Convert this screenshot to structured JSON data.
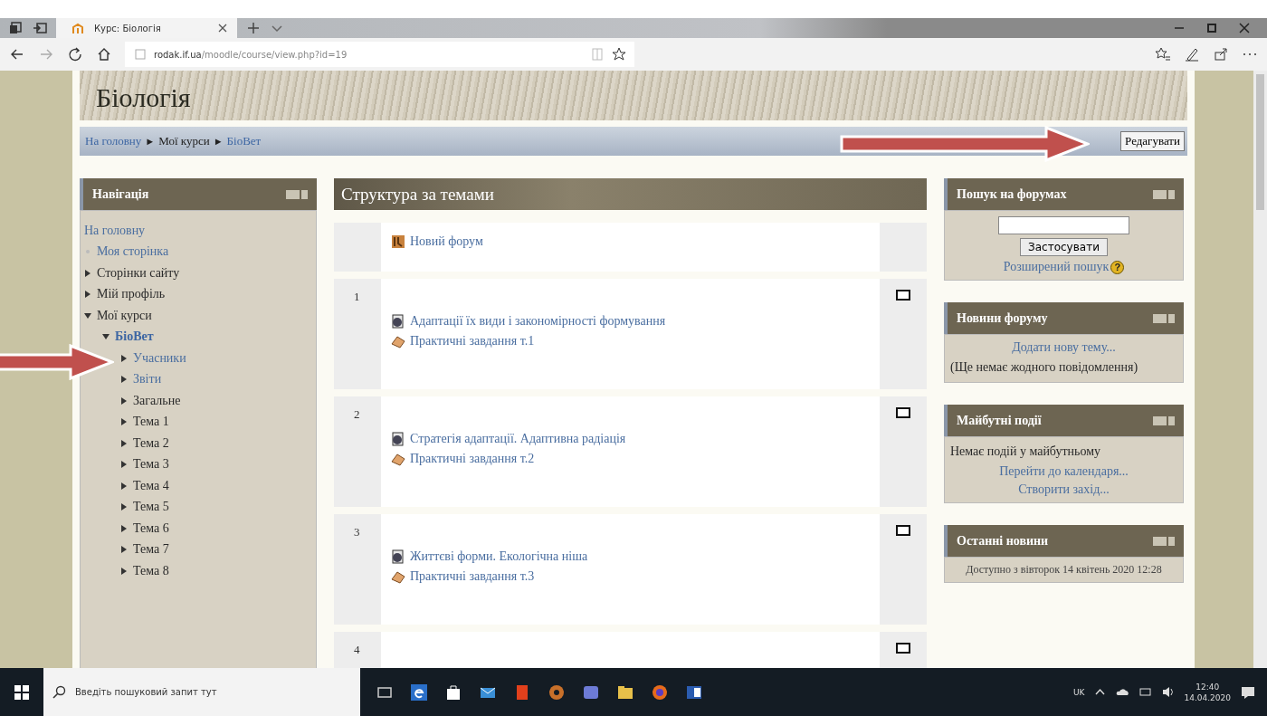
{
  "browser": {
    "tab_title": "Курс: Біологія",
    "url_host": "rodak.if.ua",
    "url_path": "/moodle/course/view.php?id=19"
  },
  "course": {
    "title": "Біологія"
  },
  "breadcrumb": {
    "items": [
      "На головну",
      "Мої курси",
      "БіоВет"
    ],
    "separator": "►"
  },
  "edit_button": "Редагувати",
  "navigation": {
    "title": "Навігація",
    "items": [
      {
        "label": "На головну",
        "kind": "home"
      },
      {
        "label": "Моя сторінка",
        "kind": "leaf"
      },
      {
        "label": "Сторінки сайту",
        "kind": "node",
        "expanded": false,
        "link": false
      },
      {
        "label": "Мій профіль",
        "kind": "node",
        "expanded": false,
        "link": false
      },
      {
        "label": "Мої курси",
        "kind": "node",
        "expanded": true,
        "link": false,
        "children": [
          {
            "label": "БіоВет",
            "kind": "node",
            "expanded": true,
            "link": true,
            "current": true,
            "children": [
              {
                "label": "Учасники",
                "kind": "node",
                "expanded": false,
                "link": true
              },
              {
                "label": "Звіти",
                "kind": "node",
                "expanded": false,
                "link": true
              },
              {
                "label": "Загальне",
                "kind": "node",
                "expanded": false,
                "link": false
              },
              {
                "label": "Тема 1",
                "kind": "node",
                "expanded": false,
                "link": false
              },
              {
                "label": "Тема 2",
                "kind": "node",
                "expanded": false,
                "link": false
              },
              {
                "label": "Тема 3",
                "kind": "node",
                "expanded": false,
                "link": false
              },
              {
                "label": "Тема 4",
                "kind": "node",
                "expanded": false,
                "link": false
              },
              {
                "label": "Тема 5",
                "kind": "node",
                "expanded": false,
                "link": false
              },
              {
                "label": "Тема 6",
                "kind": "node",
                "expanded": false,
                "link": false
              },
              {
                "label": "Тема 7",
                "kind": "node",
                "expanded": false,
                "link": false
              },
              {
                "label": "Тема 8",
                "kind": "node",
                "expanded": false,
                "link": false
              }
            ]
          }
        ]
      }
    ]
  },
  "topics": {
    "title": "Структура за темами",
    "sections": [
      {
        "activities": [
          {
            "kind": "forum",
            "title": "Новий форум"
          }
        ]
      },
      {
        "number": "1",
        "activities": [
          {
            "kind": "resource",
            "title": "Адаптації їх види і закономірності формування"
          },
          {
            "kind": "assignment",
            "title": "Практичні завдання т.1"
          }
        ]
      },
      {
        "number": "2",
        "activities": [
          {
            "kind": "resource",
            "title": "Стратегія адаптації. Адаптивна радіація"
          },
          {
            "kind": "assignment",
            "title": "Практичні завдання т.2"
          }
        ]
      },
      {
        "number": "3",
        "activities": [
          {
            "kind": "resource",
            "title": "Життєві форми. Екологічна ніша"
          },
          {
            "kind": "assignment",
            "title": "Практичні завдання т.3"
          }
        ]
      },
      {
        "number": "4"
      }
    ]
  },
  "blocks": [
    {
      "title": "Пошук на форумах",
      "items": [
        {
          "kind": "field"
        },
        {
          "kind": "button",
          "text": "Застосувати"
        },
        {
          "kind": "link",
          "text": "Розширений пошук",
          "help_icon": "?"
        }
      ]
    },
    {
      "title": "Новини форуму",
      "items": [
        {
          "kind": "link",
          "text": "Додати нову тему..."
        },
        {
          "kind": "text",
          "text": "(Ще немає жодного повідомлення)"
        }
      ]
    },
    {
      "title": "Майбутні події",
      "items": [
        {
          "kind": "text",
          "text": "Немає подій у майбутньому"
        },
        {
          "kind": "link",
          "text": "Перейти до календаря..."
        },
        {
          "kind": "link",
          "text": "Створити захід..."
        }
      ]
    },
    {
      "title": "Останні новини",
      "items": [
        {
          "kind": "note",
          "text": "Доступно з вівторок 14 квітень 2020 12:28"
        }
      ]
    }
  ],
  "taskbar": {
    "search_placeholder": "Введіть пошуковий запит тут",
    "language": "UK",
    "time": "12:40",
    "date": "14.04.2020"
  }
}
